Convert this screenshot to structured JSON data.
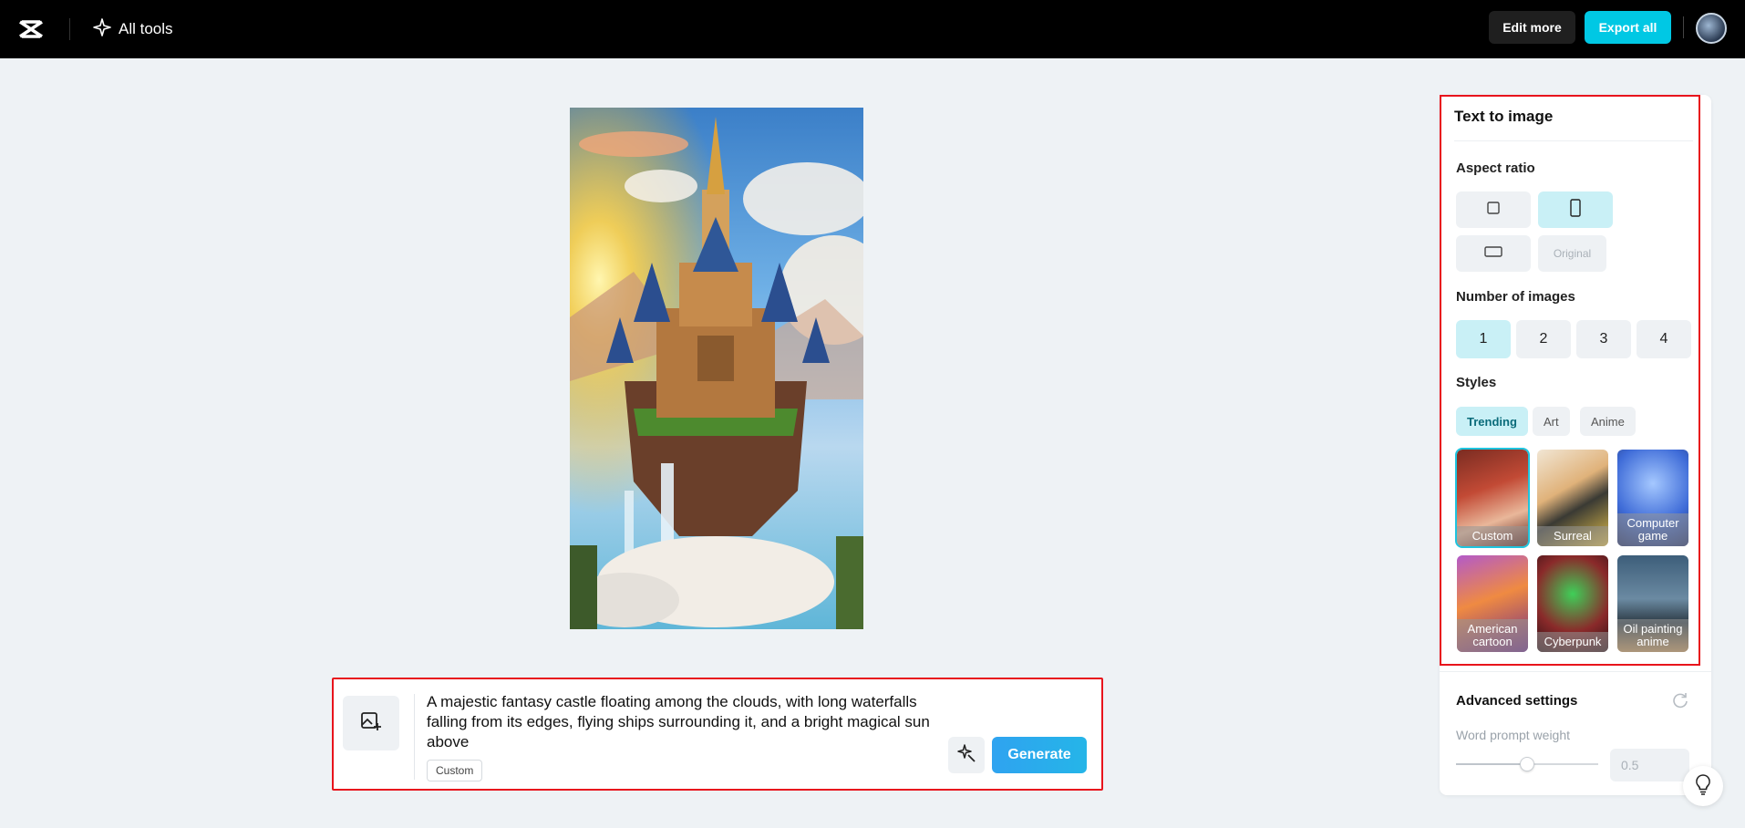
{
  "topbar": {
    "all_tools_label": "All tools",
    "edit_more_label": "Edit more",
    "export_all_label": "Export all",
    "icons": {
      "logo": "capcut-logo-icon",
      "all_tools": "sparkle-icon",
      "avatar": "avatar"
    },
    "accent_color": "#00c8e4"
  },
  "prompt": {
    "text": "A majestic fantasy castle floating among the clouds, with long waterfalls falling from its edges, flying ships surrounding it, and a bright magical sun above",
    "style_tag": "Custom",
    "generate_label": "Generate",
    "icons": {
      "image_add": "image-add-icon",
      "wand": "magic-wand-icon"
    }
  },
  "panel": {
    "title": "Text to image",
    "aspect_ratio": {
      "label": "Aspect ratio",
      "options": [
        {
          "icon": "square-ratio-icon",
          "active": false
        },
        {
          "icon": "portrait-ratio-icon",
          "active": true
        },
        {
          "icon": "landscape-ratio-icon",
          "active": false
        }
      ],
      "original_label": "Original"
    },
    "number_of_images": {
      "label": "Number of images",
      "options": [
        "1",
        "2",
        "3",
        "4"
      ],
      "selected": "1"
    },
    "styles": {
      "label": "Styles",
      "tabs": [
        "Trending",
        "Art",
        "Anime"
      ],
      "active_tab": "Trending",
      "tiles": [
        {
          "label": "Custom",
          "selected": true
        },
        {
          "label": "Surreal",
          "selected": false
        },
        {
          "label": "Computer game",
          "selected": false
        },
        {
          "label": "American cartoon",
          "selected": false
        },
        {
          "label": "Cyberpunk",
          "selected": false
        },
        {
          "label": "Oil painting anime",
          "selected": false
        }
      ]
    },
    "advanced": {
      "label": "Advanced settings",
      "word_prompt_weight_label": "Word prompt weight",
      "word_prompt_weight_value": "0.5",
      "slider_fraction": 0.5
    }
  }
}
